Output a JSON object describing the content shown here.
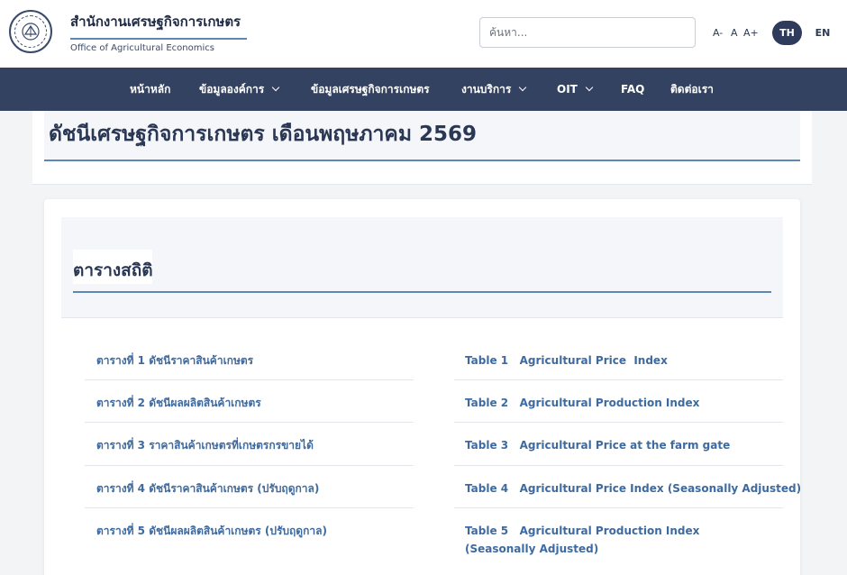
{
  "header": {
    "org_name_th": "สำนักงานเศรษฐกิจการเกษตร",
    "org_name_en": "Office of Agricultural Economics",
    "logo_icon": "agency-seal-icon",
    "search": {
      "placeholder": "ค้นหา...",
      "value": ""
    },
    "font_size": {
      "decrease": "A-",
      "normal": "A",
      "increase": "A+"
    },
    "languages": {
      "th": "TH",
      "en": "EN",
      "active": "TH"
    }
  },
  "nav": {
    "items": [
      {
        "label": "หน้าหลัก",
        "has_dropdown": false
      },
      {
        "label": "ข้อมูลองค์การ",
        "has_dropdown": true
      },
      {
        "label": "ข้อมูลเศรษฐกิจการเกษตร",
        "has_dropdown": false
      },
      {
        "label": "งานบริการ",
        "has_dropdown": true
      },
      {
        "label": "OIT",
        "has_dropdown": true
      },
      {
        "label": "FAQ",
        "has_dropdown": false
      },
      {
        "label": "ติดต่อเรา",
        "has_dropdown": false
      }
    ]
  },
  "page": {
    "title": "ดัชนีเศรษฐกิจการเกษตร เดือนพฤษภาคม 2569"
  },
  "stats": {
    "section_title": "ตารางสถิติ",
    "thai_links": [
      "ตารางที่ 1 ดัชนีราคาสินค้าเกษตร",
      "ตารางที่ 2 ดัชนีผลผลิตสินค้าเกษตร",
      "ตารางที่ 3 ราคาสินค้าเกษตรที่เกษตรกรขายได้",
      "ตารางที่ 4 ดัชนีราคาสินค้าเกษตร (ปรับฤดูกาล)",
      "ตารางที่ 5 ดัชนีผลผลิตสินค้าเกษตร (ปรับฤดูกาล)"
    ],
    "english_links": [
      "Table 1   Agricultural Price  Index",
      "Table 2   Agricultural Production Index",
      "Table 3   Agricultural Price at the farm gate",
      "Table 4   Agricultural Price Index (Seasonally Adjusted)",
      "Table 5   Agricultural Production Index (Seasonally Adjusted)"
    ]
  },
  "colors": {
    "nav_bg": "#344261",
    "accent_rule": "#5d87b4",
    "link": "#3d6aa0",
    "active_lang_bg": "#2f3b5c"
  }
}
